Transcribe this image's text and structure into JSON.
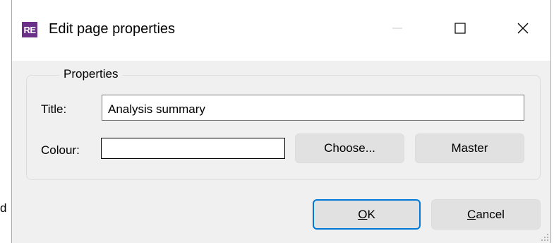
{
  "window": {
    "app_icon_text": "RE",
    "title": "Edit page properties",
    "controls": {
      "minimize": "minimize-icon",
      "maximize": "maximize-icon",
      "close": "close-icon"
    }
  },
  "properties": {
    "group_label": "Properties",
    "title_label": "Title:",
    "title_value": "Analysis summary",
    "colour_label": "Colour:",
    "choose_button": "Choose...",
    "master_button": "Master"
  },
  "footer": {
    "ok_label": "OK",
    "ok_first": "O",
    "ok_rest": "K",
    "cancel_first": "C",
    "cancel_rest": "ancel"
  },
  "background_fragment": "d",
  "colors": {
    "app_icon": "#6a2f86",
    "focus_border": "#0078d7",
    "dialog_bg": "#f0f0f0"
  }
}
